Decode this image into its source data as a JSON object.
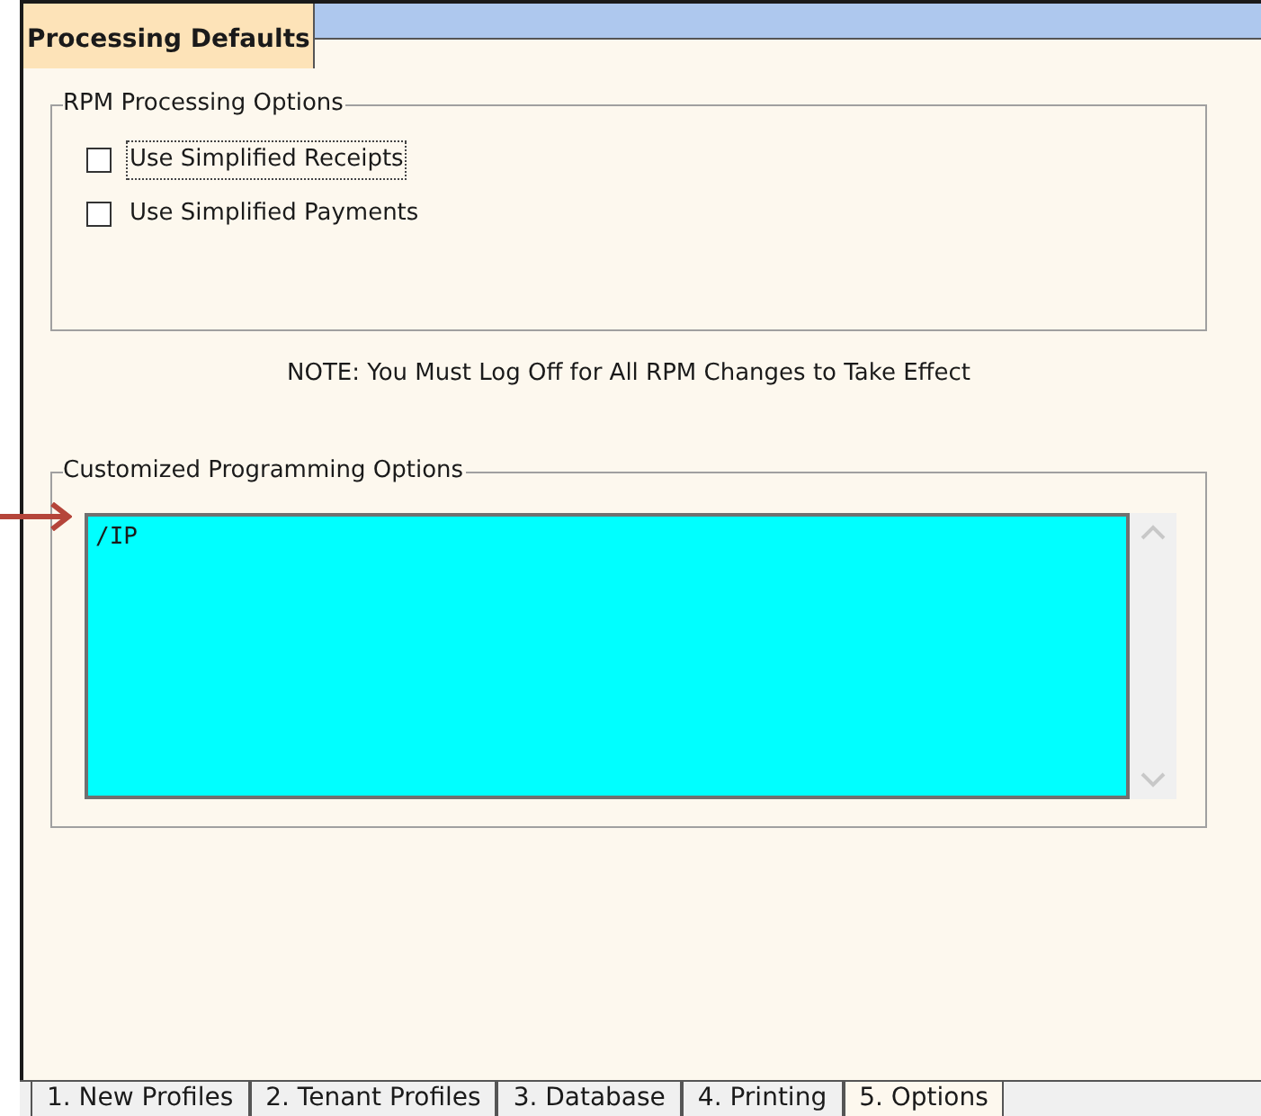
{
  "header_tab": {
    "label": "Processing Defaults"
  },
  "rpm_group": {
    "title": "RPM Processing Options",
    "options": [
      {
        "label": "Use Simplified Receipts",
        "checked": false,
        "focused": true
      },
      {
        "label": "Use Simplified Payments",
        "checked": false,
        "focused": false
      }
    ]
  },
  "note": "NOTE: You Must Log Off for All RPM Changes to Take Effect",
  "custom_group": {
    "title": "Customized Programming Options",
    "value": "/IP"
  },
  "bottom_tabs": [
    {
      "label": "1. New Profiles",
      "selected": false
    },
    {
      "label": "2. Tenant Profiles",
      "selected": false
    },
    {
      "label": "3. Database",
      "selected": false
    },
    {
      "label": "4. Printing",
      "selected": false
    },
    {
      "label": "5. Options",
      "selected": true
    }
  ]
}
